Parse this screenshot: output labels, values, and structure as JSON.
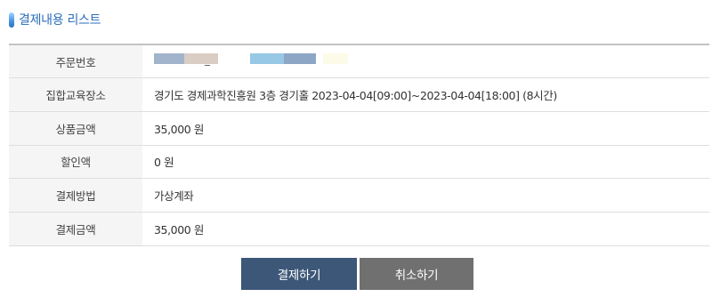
{
  "section": {
    "title": "결제내용 리스트",
    "icon": "pill-bar-icon",
    "accent_color": "#2b6db8"
  },
  "rows": [
    {
      "label": "주문번호",
      "value": "_"
    },
    {
      "label": "집합교육장소",
      "value": "경기도 경제과학진흥원 3층 경기홀 2023-04-04[09:00]~2023-04-04[18:00] (8시간)"
    },
    {
      "label": "상품금액",
      "value": "35,000 원"
    },
    {
      "label": "할인액",
      "value": "0 원"
    },
    {
      "label": "결제방법",
      "value": "가상계좌"
    },
    {
      "label": "결제금액",
      "value": "35,000 원"
    }
  ],
  "actions": {
    "pay_label": "결제하기",
    "cancel_label": "취소하기",
    "pay_color": "#3c5778",
    "cancel_color": "#707070"
  }
}
